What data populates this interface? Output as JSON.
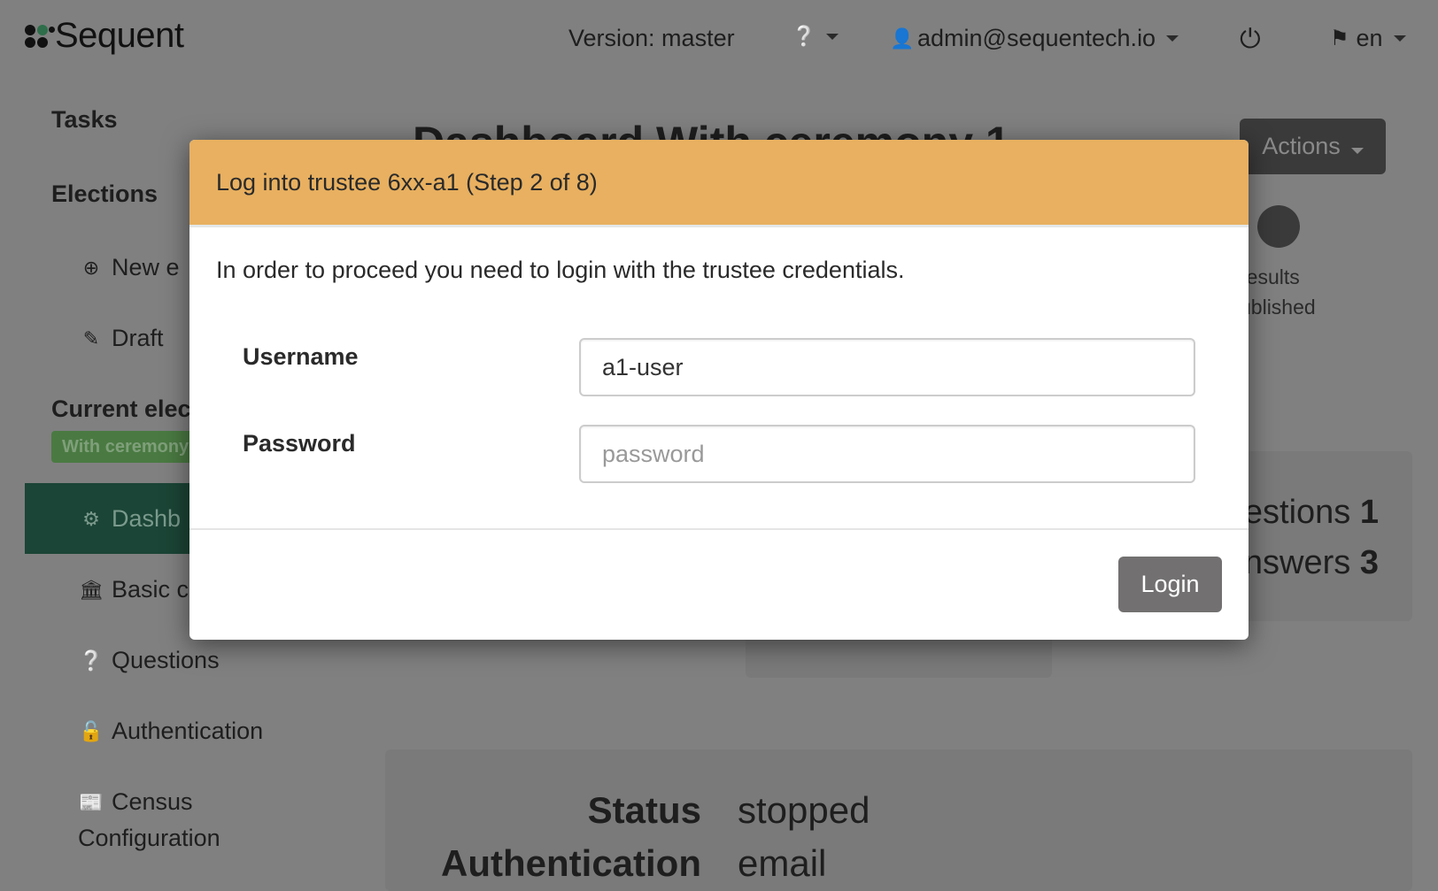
{
  "header": {
    "logo_text": "Sequent",
    "version": "Version: master",
    "user": "admin@sequentech.io",
    "language": "en"
  },
  "sidebar": {
    "tasks": "Tasks",
    "elections": "Elections",
    "new_election": "New e",
    "draft": "Draft",
    "current_election": "Current elec",
    "current_badge": "With ceremony",
    "items": [
      {
        "label": "Dashb",
        "icon": "dashboard-icon"
      },
      {
        "label": "Basic c",
        "icon": "bank-icon"
      },
      {
        "label": "Questions",
        "icon": "question-circle-icon"
      },
      {
        "label": "Authentication",
        "icon": "unlock-icon"
      },
      {
        "label": "Census",
        "label2": "Configuration",
        "icon": "census-icon"
      }
    ]
  },
  "main": {
    "title": "Dashboard With ceremony 1",
    "actions_label": "Actions",
    "step_label_1": "results",
    "step_label_2": "ublished",
    "questions_label": "estions",
    "questions_count": "1",
    "answers_label": "nswers",
    "answers_count": "3",
    "status_label": "Status",
    "status_value": "stopped",
    "auth_label": "Authentication",
    "auth_value": "email"
  },
  "modal": {
    "title": "Log into trustee 6xx-a1 (Step 2 of 8)",
    "message": "In order to proceed you need to login with the trustee credentials.",
    "username_label": "Username",
    "username_value": "a1-user",
    "password_label": "Password",
    "password_placeholder": "password",
    "login_label": "Login",
    "header_color": "#e8b060"
  }
}
